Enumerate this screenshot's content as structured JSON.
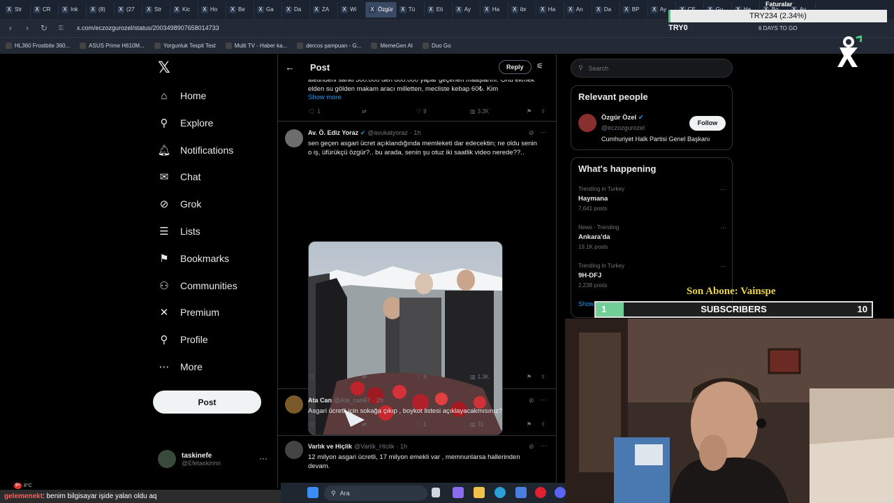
{
  "browser": {
    "tabs": [
      "Str",
      "CR",
      "Ink",
      "(8)",
      "(27",
      "Str",
      "Kic",
      "Ho",
      "Be",
      "Ga",
      "Da",
      "ZA",
      "Wi",
      "Özgür",
      "Tü",
      "Eti",
      "Ay",
      "Ha",
      "ibr",
      "Ha",
      "An",
      "Da",
      "BP",
      "Ay",
      "CE",
      "Gu",
      "Ha",
      "Bo",
      "Ay"
    ],
    "active_tab_index": 13,
    "url": "x.com/eczozgurozel/status/2003498907658014733",
    "bookmarks": [
      "HL360 Frostbite 360...",
      "ASUS Prime H610M...",
      "Yorgunluk Tespit Test",
      "Multi TV - Haber ka...",
      "dercos şampuan - G...",
      "MemeGen AI",
      "Duo Go"
    ],
    "toolbar_extra": "6 DAYS TO GO"
  },
  "sidebar": {
    "items": [
      {
        "label": "Home",
        "icon": "home-icon",
        "glyph": "⌂"
      },
      {
        "label": "Explore",
        "icon": "search-icon",
        "glyph": "⚲"
      },
      {
        "label": "Notifications",
        "icon": "bell-icon",
        "glyph": "🔔︎"
      },
      {
        "label": "Chat",
        "icon": "mail-icon",
        "glyph": "✉"
      },
      {
        "label": "Grok",
        "icon": "grok-icon",
        "glyph": "⊘"
      },
      {
        "label": "Lists",
        "icon": "list-icon",
        "glyph": "☰"
      },
      {
        "label": "Bookmarks",
        "icon": "bookmark-icon",
        "glyph": "⚑"
      },
      {
        "label": "Communities",
        "icon": "people-icon",
        "glyph": "⚇"
      },
      {
        "label": "Premium",
        "icon": "x-premium-icon",
        "glyph": "✕"
      },
      {
        "label": "Profile",
        "icon": "person-icon",
        "glyph": "⚲"
      },
      {
        "label": "More",
        "icon": "more-circle-icon",
        "glyph": "⋯"
      }
    ],
    "post_label": "Post",
    "account": {
      "name": "taskinefe",
      "handle": "@Efetaskinnn"
    }
  },
  "main": {
    "title": "Post",
    "reply_label": "Reply",
    "tweets": [
      {
        "text": "aletindeni sanki 500.000 den 800.000 yapar geçeneri maaşlarını. Onu ekmek elden su gölden makam aracı milletten, mecliste kebap 60₺. Kim",
        "show_more": "Show more",
        "replies": "1",
        "reposts": "",
        "likes": "9",
        "views": "3.2K"
      },
      {
        "name": "Av. Ö. Ediz Yoraz",
        "handle": "@avukatyoraz",
        "time": "· 1h",
        "text": "sen geçen asgari ücret açıklandığında memleketi dar edecektin; ne oldu senin o iş, üfürükçü özgür?.. bu arada, senin şu otuz iki saatlik video nerede??..",
        "replies": "",
        "reposts": "",
        "likes": "4",
        "views": "1.3K"
      },
      {
        "name": "Ata Can",
        "handle": "@Ata_can67",
        "time": "· 2h",
        "text": "Asgari ücretli için sokağa çıkıp , boykot listesi açıklayacakmısınız?",
        "replies": "",
        "reposts": "",
        "likes": "1",
        "views": "31"
      },
      {
        "name": "Varlık ve Hiçlik",
        "handle": "@Varlik_Hiclik",
        "time": "· 1h",
        "text": "12 milyon asgari ücretli, 17 milyon emekli var , memnunlarsa hallerinden devam."
      }
    ]
  },
  "right": {
    "search_placeholder": "Search",
    "relevant": {
      "title": "Relevant people",
      "name": "Özgür Özel",
      "handle": "@eczozgurozel",
      "bio": "Cumhuriyet Halk Partisi Genel Başkanı",
      "follow_label": "Follow"
    },
    "happening": {
      "title": "What's happening",
      "trends": [
        {
          "context": "Trending in Turkey",
          "name": "Haymana",
          "count": "7,641 posts"
        },
        {
          "context": "News · Trending",
          "name": "Ankara'da",
          "count": "19.1K posts"
        },
        {
          "context": "Trending in Turkey",
          "name": "9H-DFJ",
          "count": "2,238 posts"
        }
      ],
      "show_more": "Show"
    }
  },
  "overlay": {
    "faturalar": "Faturalar",
    "ticker": "TRY234 (2.34%)",
    "tryzero": "TRY0",
    "son_abone": "Son Abone: Vainspe",
    "subscribers_label": "SUBSCRIBERS",
    "subscribers_current": "1",
    "subscribers_goal": "10",
    "subscribers_fraction": 0.1
  },
  "taskbar": {
    "search_placeholder": "Ara",
    "weather": "8°C",
    "badge": "9+"
  },
  "chat": {
    "user": "gelemenekt",
    "message": ": benim bilgisayar işide yalan oldu aq"
  },
  "colors": {
    "accent": "#1d9bf0",
    "bg": "#000000",
    "border": "#2f3336",
    "muted": "#71767b"
  }
}
